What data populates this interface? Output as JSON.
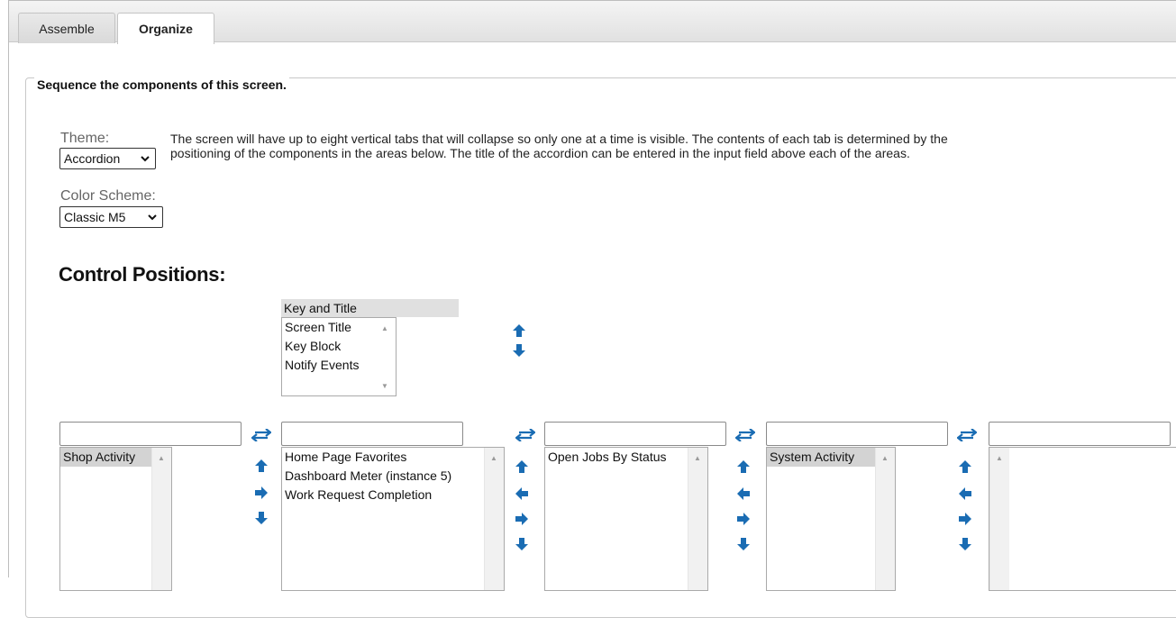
{
  "tabs": [
    {
      "label": "Assemble",
      "active": false
    },
    {
      "label": "Organize",
      "active": true
    }
  ],
  "section": {
    "legend": "Sequence the components of this screen.",
    "theme_label": "Theme:",
    "theme_value": "Accordion",
    "color_scheme_label": "Color Scheme:",
    "color_scheme_value": "Classic M5",
    "description": "The screen will have up to eight vertical tabs that will collapse so only one at a time is visible. The contents of each tab is determined by the positioning of the components in the areas below. The title of the accordion can be entered in the input field above each of the areas."
  },
  "control_positions": {
    "heading": "Control Positions:",
    "key_title": {
      "header": "Key and Title",
      "items": [
        "Screen Title",
        "Key Block",
        "Notify Events"
      ]
    },
    "areas": [
      {
        "title_value": "",
        "items": [
          "Shop Activity"
        ],
        "selected": 0
      },
      {
        "title_value": "",
        "items": [
          "Home Page Favorites",
          "Dashboard Meter (instance 5)",
          "Work Request Completion"
        ],
        "selected": -1
      },
      {
        "title_value": "",
        "items": [
          "Open Jobs By Status"
        ],
        "selected": -1
      },
      {
        "title_value": "",
        "items": [
          "System Activity"
        ],
        "selected": 0
      },
      {
        "title_value": "",
        "items": [],
        "selected": -1
      }
    ]
  },
  "colors": {
    "arrow_blue": "#1a6cb3",
    "selected_bg": "#d3d3d3"
  },
  "icons": {
    "move_up": "arrow-up-icon",
    "move_down": "arrow-down-icon",
    "move_left": "arrow-left-icon",
    "move_right": "arrow-right-icon",
    "swap": "swap-icon"
  }
}
